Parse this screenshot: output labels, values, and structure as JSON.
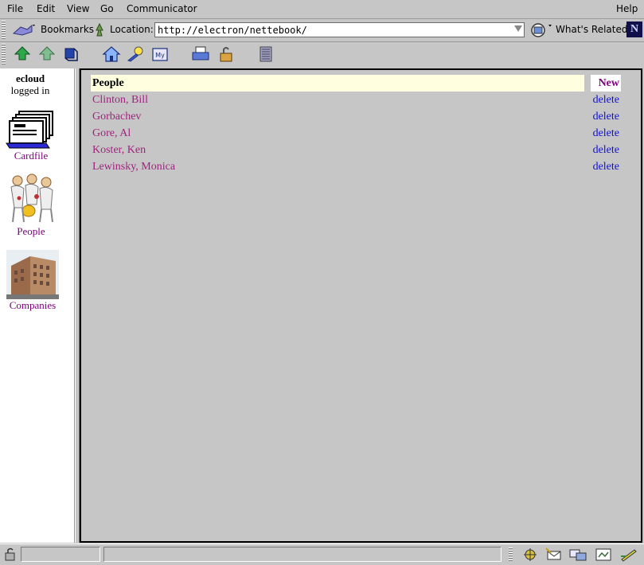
{
  "menu": {
    "file": "File",
    "edit": "Edit",
    "view": "View",
    "go": "Go",
    "communicator": "Communicator",
    "help": "Help"
  },
  "location_bar": {
    "bookmarks_label": "Bookmarks",
    "location_label": "Location:",
    "url": "http://electron/nettebook/",
    "whats_related_label": "What's Related",
    "netscape_logo": "N"
  },
  "toolbar": {
    "icons": [
      "back-icon",
      "forward-icon",
      "reload-icon",
      "home-icon",
      "search-icon",
      "my-netscape-icon",
      "print-icon",
      "security-icon",
      "stop-icon"
    ]
  },
  "sidebar": {
    "username": "ecloud",
    "status": "logged in",
    "items": [
      {
        "label": "Cardfile"
      },
      {
        "label": "People"
      },
      {
        "label": "Companies"
      }
    ]
  },
  "people": {
    "title": "People",
    "new_label": "New",
    "delete_label": "delete",
    "rows": [
      {
        "name": "Clinton, Bill"
      },
      {
        "name": "Gorbachev"
      },
      {
        "name": "Gore, Al"
      },
      {
        "name": "Koster, Ken"
      },
      {
        "name": "Lewinsky, Monica"
      }
    ]
  },
  "colors": {
    "chrome": "#c6c6c6",
    "header_bg": "#ffffe0",
    "person_link": "#a0227e",
    "delete_link": "#1111cc",
    "visited_link": "#800080"
  }
}
